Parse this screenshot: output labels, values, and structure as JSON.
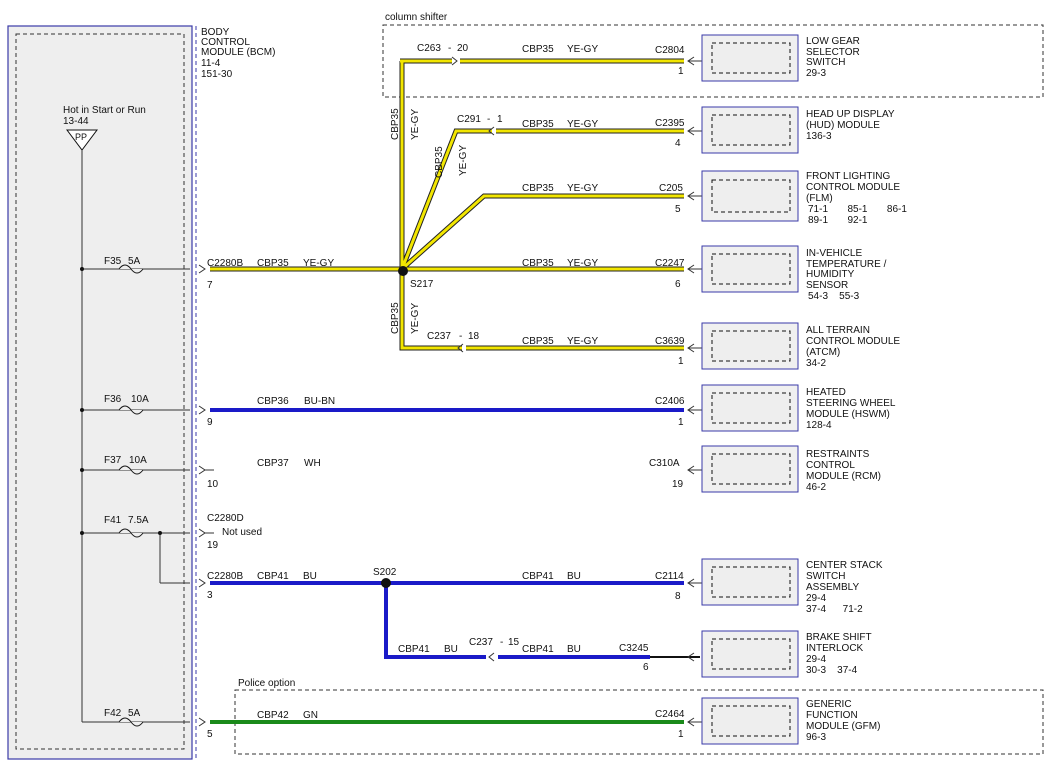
{
  "bcm": {
    "label_lines": [
      "BODY",
      "CONTROL",
      "MODULE (BCM)",
      "11-4",
      "151-30"
    ],
    "hot_label": "Hot in Start or Run",
    "hot_ref": "13-44",
    "pp": "PP"
  },
  "groups": {
    "column_shifter": "column shifter",
    "police_option": "Police option"
  },
  "fuses": [
    {
      "id": "F35",
      "rating": "5A"
    },
    {
      "id": "F36",
      "rating": "10A"
    },
    {
      "id": "F37",
      "rating": "10A"
    },
    {
      "id": "F41",
      "rating": "7.5A"
    },
    {
      "id": "F42",
      "rating": "5A"
    }
  ],
  "bcm_pins": [
    {
      "connector": "C2280B",
      "pin": "7"
    },
    {
      "connector": "",
      "pin": "9"
    },
    {
      "connector": "",
      "pin": "10"
    },
    {
      "connector": "C2280D",
      "pin": "19",
      "note": "Not used"
    },
    {
      "connector": "C2280B",
      "pin": "3"
    },
    {
      "connector": "",
      "pin": "5"
    }
  ],
  "splices": {
    "s217": "S217",
    "s202": "S202"
  },
  "wires": {
    "cbp35": {
      "circuit": "CBP35",
      "color": "YE-GY"
    },
    "cbp36": {
      "circuit": "CBP36",
      "color": "BU-BN"
    },
    "cbp37": {
      "circuit": "CBP37",
      "color": "WH"
    },
    "cbp41": {
      "circuit": "CBP41",
      "color": "BU"
    },
    "cbp42": {
      "circuit": "CBP42",
      "color": "GN"
    }
  },
  "inline_connectors": {
    "c263": {
      "id": "C263",
      "sep": "-",
      "pin": "20"
    },
    "c291": {
      "id": "C291",
      "sep": "-",
      "pin": "1"
    },
    "c237a": {
      "id": "C237",
      "sep": "-",
      "pin": "18"
    },
    "c237b": {
      "id": "C237",
      "sep": "-",
      "pin": "15"
    }
  },
  "modules": [
    {
      "connector": "C2804",
      "pin": "1",
      "lines": [
        "LOW GEAR",
        "SELECTOR",
        "SWITCH",
        "29-3"
      ]
    },
    {
      "connector": "C2395",
      "pin": "4",
      "lines": [
        "HEAD UP DISPLAY",
        "(HUD) MODULE",
        "136-3"
      ]
    },
    {
      "connector": "C205",
      "pin": "5",
      "lines": [
        "FRONT LIGHTING",
        "CONTROL MODULE",
        "(FLM)",
        "71-1       85-1       86-1",
        "89-1       92-1"
      ]
    },
    {
      "connector": "C2247",
      "pin": "6",
      "lines": [
        "IN-VEHICLE",
        "TEMPERATURE /",
        "HUMIDITY",
        "SENSOR",
        "54-3    55-3"
      ]
    },
    {
      "connector": "C3639",
      "pin": "1",
      "lines": [
        "ALL TERRAIN",
        "CONTROL MODULE",
        "(ATCM)",
        "34-2"
      ]
    },
    {
      "connector": "C2406",
      "pin": "1",
      "lines": [
        "HEATED",
        "STEERING WHEEL",
        "MODULE (HSWM)",
        "128-4"
      ]
    },
    {
      "connector": "C310A",
      "pin": "19",
      "lines": [
        "RESTRAINTS",
        "CONTROL",
        "MODULE (RCM)",
        "46-2"
      ]
    },
    {
      "connector": "C2114",
      "pin": "8",
      "lines": [
        "CENTER STACK",
        "SWITCH",
        "ASSEMBLY",
        "29-4",
        "37-4      71-2"
      ]
    },
    {
      "connector": "C3245",
      "pin": "6",
      "lines": [
        "BRAKE SHIFT",
        "INTERLOCK",
        "29-4",
        "30-3    37-4"
      ]
    },
    {
      "connector": "C2464",
      "pin": "1",
      "lines": [
        "GENERIC",
        "FUNCTION",
        "MODULE (GFM)",
        "96-3"
      ]
    }
  ]
}
